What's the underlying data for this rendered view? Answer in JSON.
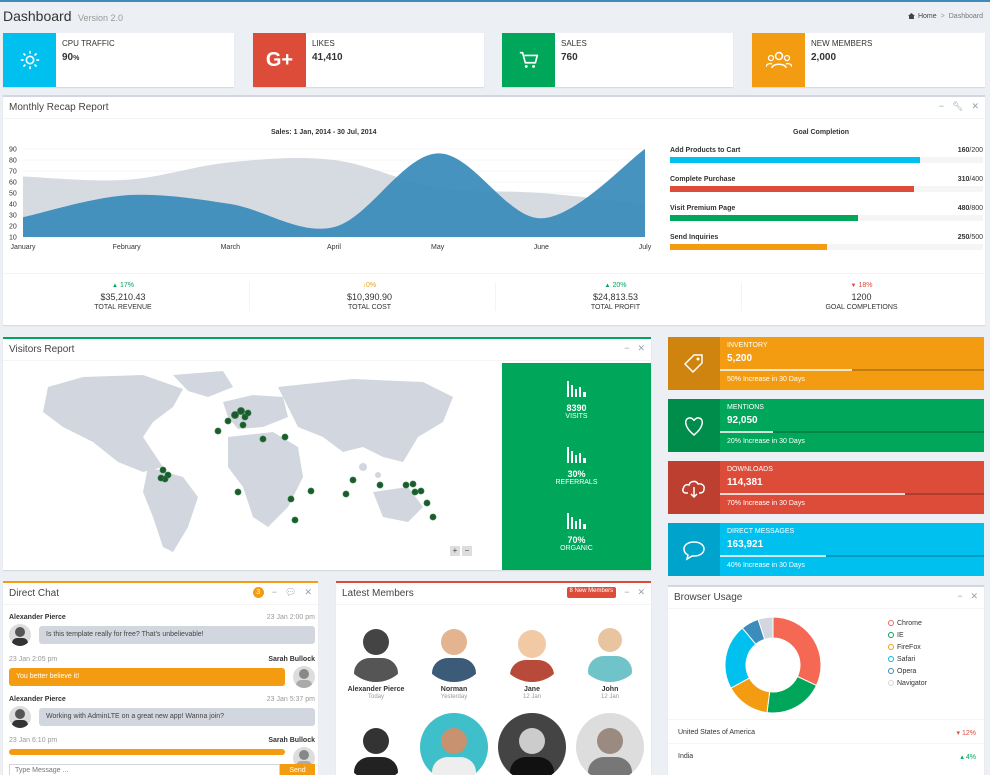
{
  "header": {
    "title": "Dashboard",
    "subtitle": "Version 2.0",
    "breadcrumb_home": "Home",
    "breadcrumb_current": "Dashboard"
  },
  "info_boxes": [
    {
      "label": "CPU TRAFFIC",
      "value": "90",
      "unit": "%",
      "color": "#00c0ef",
      "icon": "gear-icon"
    },
    {
      "label": "LIKES",
      "value": "41,410",
      "color": "#dd4b39",
      "icon": "google-plus-icon"
    },
    {
      "label": "SALES",
      "value": "760",
      "color": "#00a65a",
      "icon": "shopping-cart-icon"
    },
    {
      "label": "NEW MEMBERS",
      "value": "2,000",
      "color": "#f39c12",
      "icon": "users-icon"
    }
  ],
  "recap": {
    "title": "Monthly Recap Report",
    "chart_title": "Sales: 1 Jan, 2014 - 30 Jul, 2014",
    "goal_title": "Goal Completion",
    "goals": [
      {
        "name": "Add Products to Cart",
        "done": "160",
        "total": "/200",
        "fraction": 0.8,
        "color": "#00c0ef"
      },
      {
        "name": "Complete Purchase",
        "done": "310",
        "total": "/400",
        "fraction": 0.78,
        "color": "#dd4b39"
      },
      {
        "name": "Visit Premium Page",
        "done": "480",
        "total": "/800",
        "fraction": 0.6,
        "color": "#00a65a"
      },
      {
        "name": "Send Inquiries",
        "done": "250",
        "total": "/500",
        "fraction": 0.5,
        "color": "#f39c12"
      }
    ],
    "footer": [
      {
        "pct": "17%",
        "dir": "up",
        "color": "#00a65a",
        "amount": "$35,210.43",
        "label": "TOTAL REVENUE"
      },
      {
        "pct": "0%",
        "dir": "flat",
        "color": "#f39c12",
        "amount": "$10,390.90",
        "label": "TOTAL COST"
      },
      {
        "pct": "20%",
        "dir": "up",
        "color": "#00a65a",
        "amount": "$24,813.53",
        "label": "TOTAL PROFIT"
      },
      {
        "pct": "18%",
        "dir": "down",
        "color": "#dd4b39",
        "amount": "1200",
        "label": "GOAL COMPLETIONS"
      }
    ]
  },
  "chart_data": {
    "type": "area",
    "title": "Sales: 1 Jan, 2014 - 30 Jul, 2014",
    "x": [
      "January",
      "February",
      "March",
      "April",
      "May",
      "June",
      "July"
    ],
    "y_ticks": [
      "10",
      "20",
      "30",
      "40",
      "50",
      "60",
      "70",
      "80",
      "90"
    ],
    "ylim": [
      10,
      90
    ],
    "series": [
      {
        "values": [
          65,
          62,
          78,
          80,
          55,
          50,
          40
        ],
        "color": "#d2d6de"
      },
      {
        "values": [
          28,
          48,
          40,
          19,
          86,
          27,
          90
        ],
        "color": "#3c8dbc"
      }
    ]
  },
  "visitors": {
    "title": "Visitors Report",
    "stats": [
      {
        "value": "8390",
        "label": "VISITS"
      },
      {
        "value": "30%",
        "label": "REFERRALS"
      },
      {
        "value": "70%",
        "label": "ORGANIC"
      }
    ],
    "zoom_in": "+",
    "zoom_out": "−",
    "panel_color": "#00a65a"
  },
  "stat_boxes": [
    {
      "label": "INVENTORY",
      "value": "5,200",
      "desc": "50% Increase in 30 Days",
      "progress": 0.5,
      "color": "#f39c12",
      "icon": "tag-icon"
    },
    {
      "label": "MENTIONS",
      "value": "92,050",
      "desc": "20% Increase in 30 Days",
      "progress": 0.2,
      "color": "#00a65a",
      "icon": "heart-icon"
    },
    {
      "label": "DOWNLOADS",
      "value": "114,381",
      "desc": "70% Increase in 30 Days",
      "progress": 0.7,
      "color": "#dd4b39",
      "icon": "cloud-download-icon"
    },
    {
      "label": "DIRECT MESSAGES",
      "value": "163,921",
      "desc": "40% Increase in 30 Days",
      "progress": 0.4,
      "color": "#00c0ef",
      "icon": "chat-bubble-icon"
    }
  ],
  "chat": {
    "title": "Direct Chat",
    "badge": "3",
    "messages": [
      {
        "name": "Alexander Pierce",
        "time": "23 Jan 2:00 pm",
        "text": "Is this template really for free? That's unbelievable!",
        "side": "left"
      },
      {
        "name": "Sarah Bullock",
        "time": "23 Jan 2:05 pm",
        "text": "You better believe it!",
        "side": "right"
      },
      {
        "name": "Alexander Pierce",
        "time": "23 Jan 5:37 pm",
        "text": "Working with AdminLTE on a great new app! Wanna join?",
        "side": "left"
      },
      {
        "name": "Sarah Bullock",
        "time": "23 Jan 6:10 pm",
        "text": "",
        "side": "right"
      }
    ],
    "placeholder": "Type Message ...",
    "send": "Send"
  },
  "members": {
    "title": "Latest Members",
    "badge": "8 New Members",
    "list": [
      {
        "name": "Alexander Pierce",
        "date": "Today",
        "bg": "#e8e8e8"
      },
      {
        "name": "Norman",
        "date": "Yesterday",
        "bg": "#7a5a44"
      },
      {
        "name": "Jane",
        "date": "12 Jan",
        "bg": "#e49a3a"
      },
      {
        "name": "John",
        "date": "12 Jan",
        "bg": "#f0f0f0"
      }
    ]
  },
  "browser": {
    "title": "Browser Usage",
    "legend": [
      {
        "name": "Chrome",
        "color": "#f56954"
      },
      {
        "name": "IE",
        "color": "#00a65a"
      },
      {
        "name": "FireFox",
        "color": "#f39c12"
      },
      {
        "name": "Safari",
        "color": "#00c0ef"
      },
      {
        "name": "Opera",
        "color": "#3c8dbc"
      },
      {
        "name": "Navigator",
        "color": "#d2d6de"
      }
    ],
    "shares": [
      0.32,
      0.2,
      0.15,
      0.22,
      0.06,
      0.05
    ],
    "rows": [
      {
        "country": "United States of America",
        "pct": "12%",
        "dir": "down",
        "color": "#dd4b39"
      },
      {
        "country": "India",
        "pct": "4%",
        "dir": "up",
        "color": "#00a65a"
      }
    ]
  }
}
